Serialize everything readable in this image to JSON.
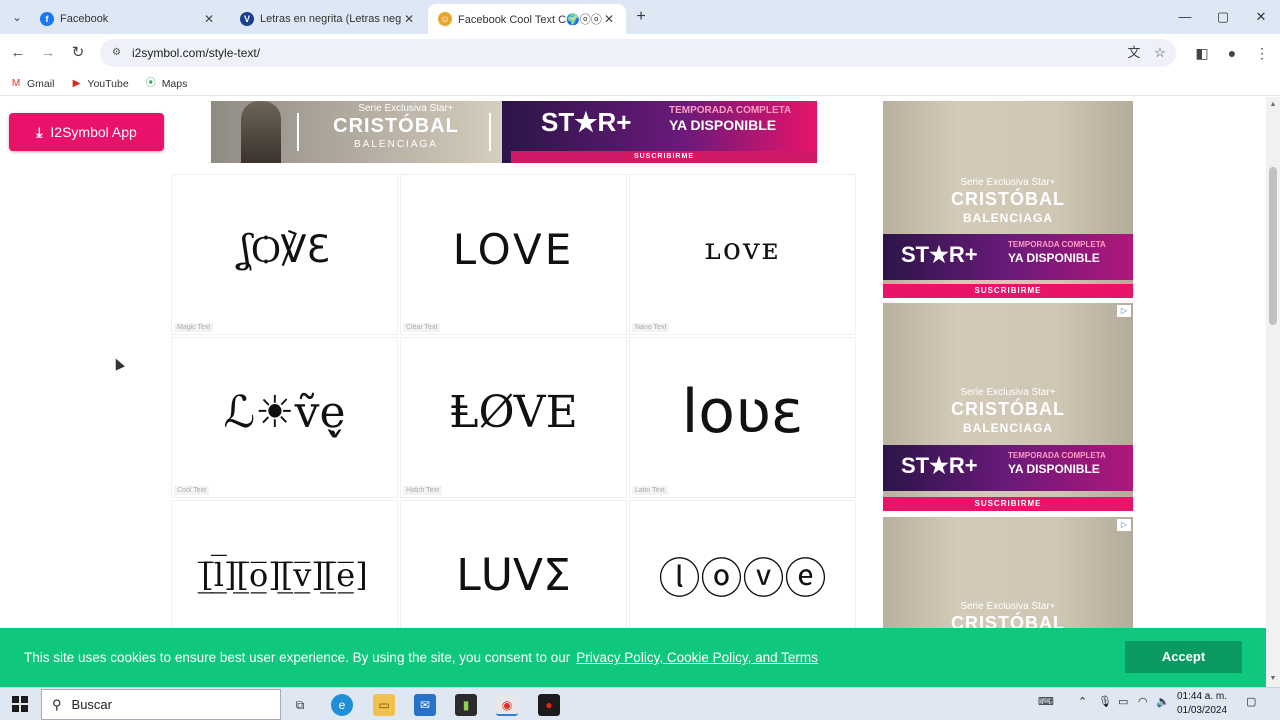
{
  "browser": {
    "tabs": [
      {
        "title": "Facebook",
        "fav_color": "#1877f2",
        "fav_glyph": "f"
      },
      {
        "title": "Letras en negrita (Letras negrita",
        "fav_color": "#1a3f8e",
        "fav_glyph": "V"
      },
      {
        "title": "Facebook Cool Text C🌍ⓞⓞ",
        "fav_color": "#e9a52c",
        "fav_glyph": "☺"
      }
    ],
    "url": "i2symbol.com/style-text/",
    "bookmarks": [
      {
        "label": "Gmail",
        "glyph": "M",
        "color": "#d93025"
      },
      {
        "label": "YouTube",
        "glyph": "▶",
        "color": "#e62117"
      },
      {
        "label": "Maps",
        "glyph": "⦿",
        "color": "#34a853"
      }
    ]
  },
  "page": {
    "app_button": "I2Symbol App",
    "top_banner": {
      "serie": "Serie Exclusiva Star+",
      "title": "CRISTÓBAL",
      "subtitle": "BALENCIAGA",
      "brand": "ST★R+",
      "temporada": "TEMPORADA COMPLETA",
      "ya": "YA DISPONIBLE",
      "cta": "SUSCRIBIRME"
    },
    "cards": [
      {
        "sample": "ʆѺ℣ℇ",
        "label": "Magic Text"
      },
      {
        "sample": "LOVE",
        "label": "Clear Text"
      },
      {
        "sample": "ʟᴏᴠᴇ",
        "label": "Nano Text"
      },
      {
        "sample": "ℒ☀ṽẹ̬",
        "label": "Cool Text"
      },
      {
        "sample": "ⱠØVE",
        "label": "Hatch Text"
      },
      {
        "sample": "loʋɛ",
        "label": "Latin Text"
      },
      {
        "sample": "[̲̅l̲̅][̲̅o̲̅][̲̅v̲̅][̲̅e̲̅]",
        "label": ""
      },
      {
        "sample": "LᑌVΣ",
        "label": ""
      },
      {
        "sample": "ⓛⓞⓥⓔ",
        "label": ""
      }
    ],
    "side_ads": [
      {
        "serie": "Serie Exclusiva Star+",
        "title": "CRISTÓBAL",
        "subtitle": "BALENCIAGA",
        "brand": "ST★R+",
        "temporada": "TEMPORADA COMPLETA",
        "ya": "YA DISPONIBLE",
        "cta": "SUSCRIBIRME"
      },
      {
        "serie": "Serie Exclusiva Star+",
        "title": "CRISTÓBAL",
        "subtitle": "BALENCIAGA",
        "brand": "ST★R+",
        "temporada": "TEMPORADA COMPLETA",
        "ya": "YA DISPONIBLE",
        "cta": "SUSCRIBIRME"
      },
      {
        "serie": "Serie Exclusiva Star+",
        "title": "CRISTÓBAL",
        "subtitle": "",
        "brand": "",
        "temporada": "",
        "ya": "",
        "cta": ""
      }
    ],
    "cookie": {
      "message": "This site uses cookies to ensure best user experience. By using the site, you consent to our",
      "link": "Privacy Policy, Cookie Policy, and Terms",
      "accept": "Accept"
    }
  },
  "taskbar": {
    "search_placeholder": "Buscar",
    "time": "01:44 a. m.",
    "date": "01/03/2024"
  },
  "colors": {
    "cookie_bg": "#0fc87e",
    "app_button": "#e8126b",
    "tabbar": "#dee8f5"
  }
}
